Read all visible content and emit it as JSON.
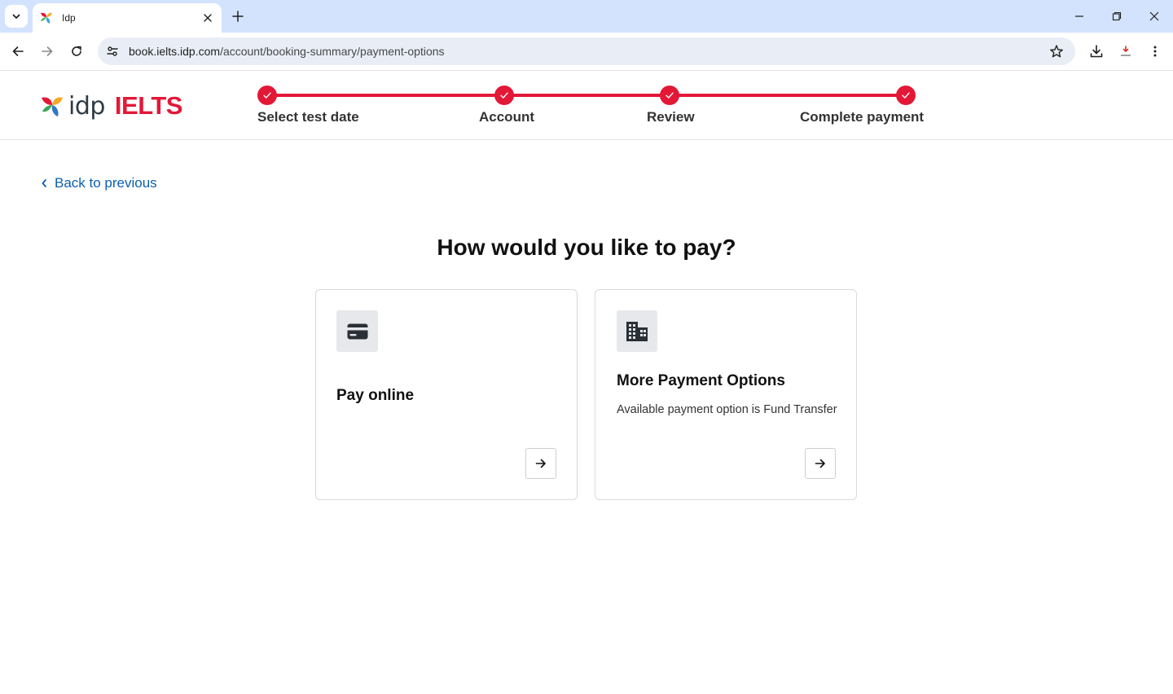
{
  "browser": {
    "tab_title": "Idp",
    "url_host": "book.ielts.idp.com",
    "url_path": "/account/booking-summary/payment-options"
  },
  "header": {
    "logo_idp": "idp",
    "logo_ielts": "IELTS",
    "steps": [
      {
        "label": "Select test date",
        "state": "complete"
      },
      {
        "label": "Account",
        "state": "complete"
      },
      {
        "label": "Review",
        "state": "complete"
      },
      {
        "label": "Complete payment",
        "state": "complete"
      }
    ]
  },
  "main": {
    "back_label": "Back to previous",
    "title": "How would you like to pay?",
    "options": [
      {
        "title": "Pay online",
        "description": "",
        "icon": "credit-card-icon"
      },
      {
        "title": "More Payment Options",
        "description": "Available payment option is Fund Transfer",
        "icon": "building-icon"
      }
    ]
  },
  "colors": {
    "brand_red": "#e31837",
    "link_blue": "#0b5fb0",
    "chrome_tab_bar": "#d3e3fd"
  }
}
